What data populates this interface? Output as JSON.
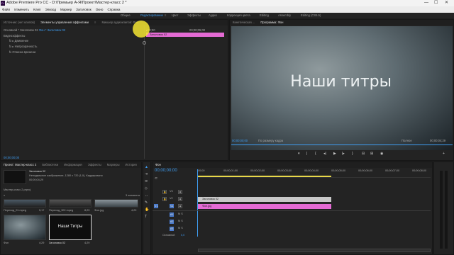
{
  "window": {
    "title": "Adobe Premiere Pro CC - D:\\Премьер А-Я\\Проект\\Мастер-класс 2 *",
    "minimize": "—",
    "maximize": "☐",
    "close": "✕"
  },
  "menu": [
    "Файл",
    "Изменить",
    "Клип",
    "Эпизод",
    "Маркер",
    "Заголовок",
    "Окно",
    "Справка"
  ],
  "workspaces": [
    "Общее",
    "Редактирование",
    "≡",
    "Цвет",
    "Эффекты",
    "Аудио",
    "Коррекция цвета",
    "Editing",
    "Assembly",
    "Editing (CS5.5)"
  ],
  "effect_controls": {
    "tabs": [
      "Источник: (нет клипов)",
      "Элементы управления эффектами",
      "≡",
      "Микшер аудиоклипов: Фон"
    ],
    "breadcrumb_main": "Основной * Заголовок 02",
    "breadcrumb_clip": "Фон * Заголовок 02",
    "header": "Видеоэффекты",
    "timecode_start": "▸00;00",
    "timecode_mid": "00;00;05;00",
    "clip_label": "Заголовок 02",
    "rows": [
      "fx ▸ Движение",
      "fx ▸ Непрозрачность",
      "fx  Отмена времени"
    ],
    "footer_tc": "00;00;00;00"
  },
  "program": {
    "tab": "Программа: Фон",
    "tab2": "Кинетическая ...",
    "title_text": "Наши титры",
    "timecode": "00;00;00;00",
    "fit": "По размеру кадра",
    "quality": "Полное",
    "duration": "00;00;04;29"
  },
  "project": {
    "tabs": [
      "Проект: Мастер-класс 2",
      "Библиотеки",
      "Информация",
      "Эффекты",
      "Маркеры",
      "История"
    ],
    "selected_name": "Заголовок 02",
    "selected_info1": "Неподвижное изображение, 1280 x 720 (1,0), Кадрировано",
    "selected_info2": "00;00;04;29",
    "path": "Мастер-класс 2.prproj",
    "count": "3 элемента",
    "items": [
      {
        "name": "Переход_01.mpeg",
        "dur": "5;17"
      },
      {
        "name": "Переход_302.mpeg",
        "dur": "8;29"
      },
      {
        "name": "Фон.jpg",
        "dur": "4;29"
      },
      {
        "name": "Фон",
        "dur": "4;29"
      },
      {
        "name": "Заголовок 02",
        "dur": "4;29",
        "thumb_text": "Наши Титры"
      }
    ]
  },
  "timeline": {
    "tab": "Фон",
    "timecode": "00;00;00;00",
    "ruler": [
      "00;00",
      "00;00;01;00",
      "00;00;02;00",
      "00;00;03;00",
      "00;00;04;00",
      "00;00;05;00",
      "00;00;06;00",
      "00;00;07;00",
      "00;00;08;00"
    ],
    "tracks_v": [
      "V3",
      "V2",
      "V1"
    ],
    "tracks_a": [
      "A1",
      "A2",
      "A3"
    ],
    "master": "Основной",
    "master_val": "0,0",
    "clip_v2": "Заголовок 02",
    "clip_v1": "Фон.jpg"
  },
  "colors": {
    "accent": "#3e9cf0",
    "clip_pink": "#e46bd4",
    "clip_gray": "#c8c8c8",
    "cursor_highlight": "#f5e533"
  }
}
